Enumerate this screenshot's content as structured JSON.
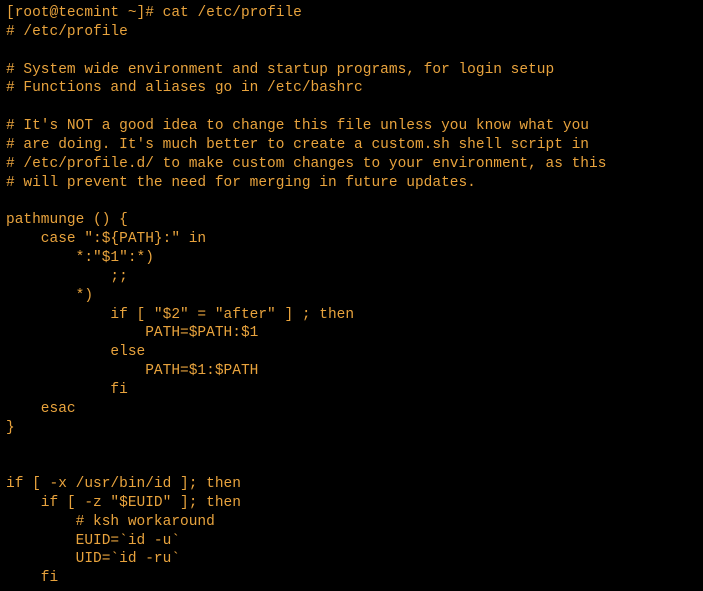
{
  "terminal": {
    "prompt": {
      "open_bracket": "[",
      "user": "root",
      "at": "@",
      "host": "tecmint",
      "path": " ~",
      "close_bracket": "]",
      "hash": "# "
    },
    "command": "cat /etc/profile",
    "lines": [
      "# /etc/profile",
      "",
      "# System wide environment and startup programs, for login setup",
      "# Functions and aliases go in /etc/bashrc",
      "",
      "# It's NOT a good idea to change this file unless you know what you",
      "# are doing. It's much better to create a custom.sh shell script in",
      "# /etc/profile.d/ to make custom changes to your environment, as this",
      "# will prevent the need for merging in future updates.",
      "",
      "pathmunge () {",
      "    case \":${PATH}:\" in",
      "        *:\"$1\":*)",
      "            ;;",
      "        *)",
      "            if [ \"$2\" = \"after\" ] ; then",
      "                PATH=$PATH:$1",
      "            else",
      "                PATH=$1:$PATH",
      "            fi",
      "    esac",
      "}",
      "",
      "",
      "if [ -x /usr/bin/id ]; then",
      "    if [ -z \"$EUID\" ]; then",
      "        # ksh workaround",
      "        EUID=`id -u`",
      "        UID=`id -ru`",
      "    fi"
    ]
  }
}
